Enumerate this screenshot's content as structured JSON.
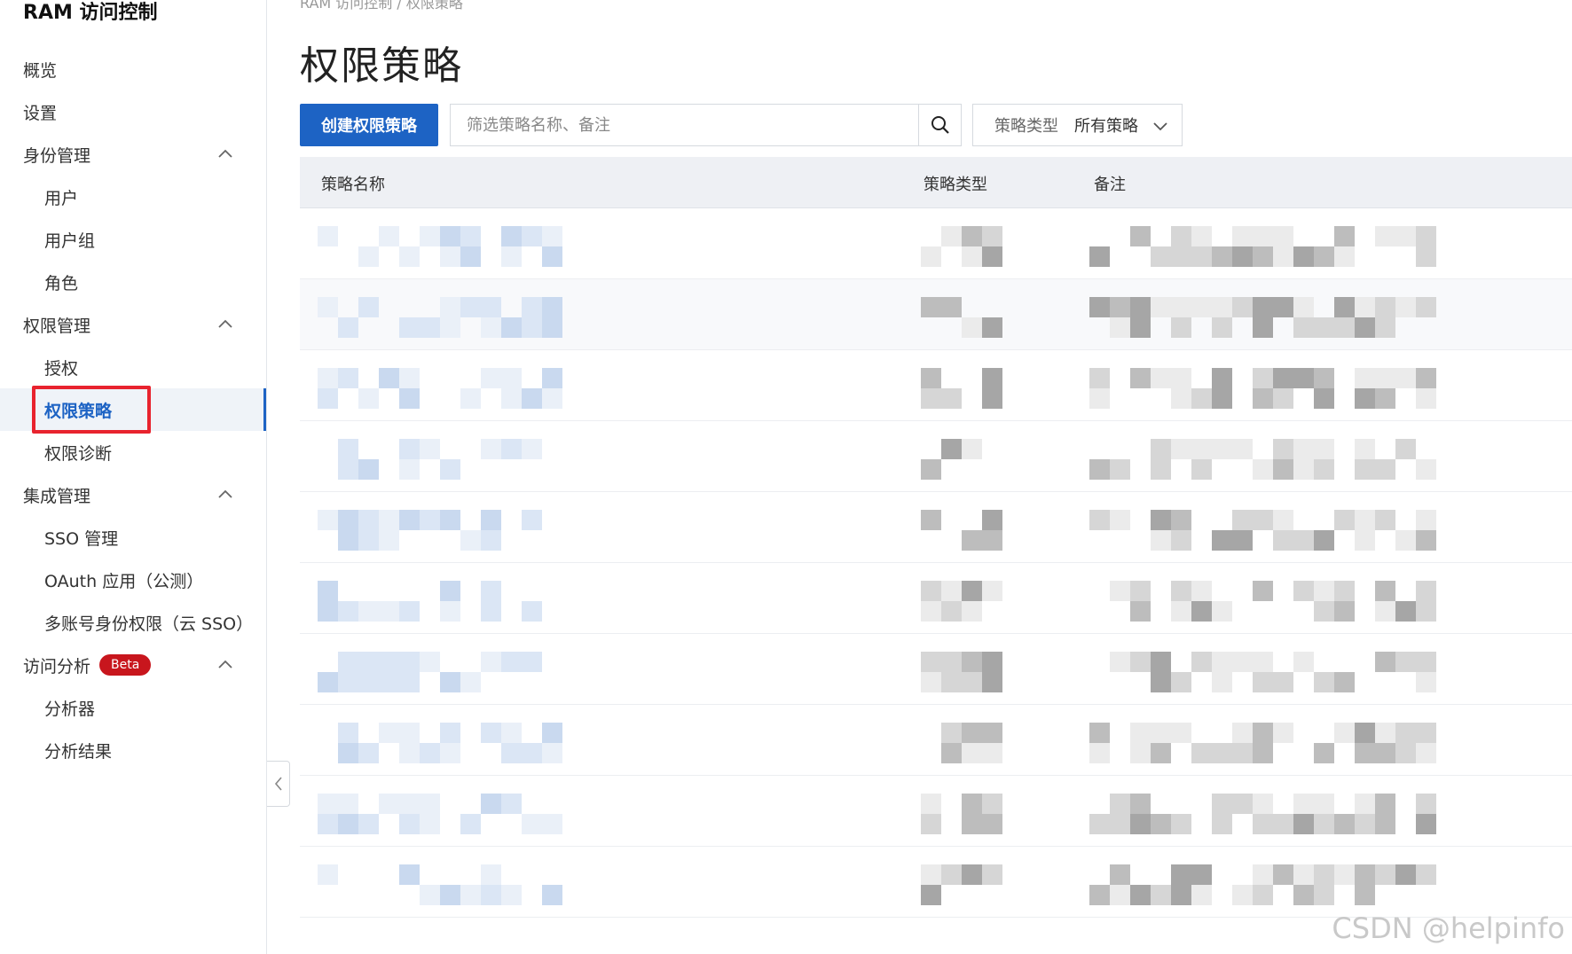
{
  "app": {
    "title": "RAM 访问控制"
  },
  "sidebar": {
    "items": [
      {
        "label": "概览"
      },
      {
        "label": "设置"
      },
      {
        "label": "身份管理"
      },
      {
        "label": "用户"
      },
      {
        "label": "用户组"
      },
      {
        "label": "角色"
      },
      {
        "label": "权限管理"
      },
      {
        "label": "授权"
      },
      {
        "label": "权限策略"
      },
      {
        "label": "权限诊断"
      },
      {
        "label": "集成管理"
      },
      {
        "label": "SSO 管理"
      },
      {
        "label": "OAuth 应用（公测）"
      },
      {
        "label": "多账号身份权限（云 SSO）"
      },
      {
        "label": "访问分析",
        "badge": "Beta"
      },
      {
        "label": "分析器"
      },
      {
        "label": "分析结果"
      }
    ],
    "active": "权限策略"
  },
  "breadcrumb": "RAM 访问控制  /  权限策略",
  "page": {
    "title": "权限策略"
  },
  "toolbar": {
    "create_label": "创建权限策略",
    "search_placeholder": "筛选策略名称、备注",
    "type_label": "策略类型",
    "type_value": "所有策略"
  },
  "table": {
    "headers": [
      "策略名称",
      "策略类型",
      "备注"
    ]
  },
  "watermark": "CSDN @helpinfo",
  "colors": {
    "accent": "#1d63c4",
    "badge": "#c8161d",
    "highlight": "#e8232e"
  }
}
